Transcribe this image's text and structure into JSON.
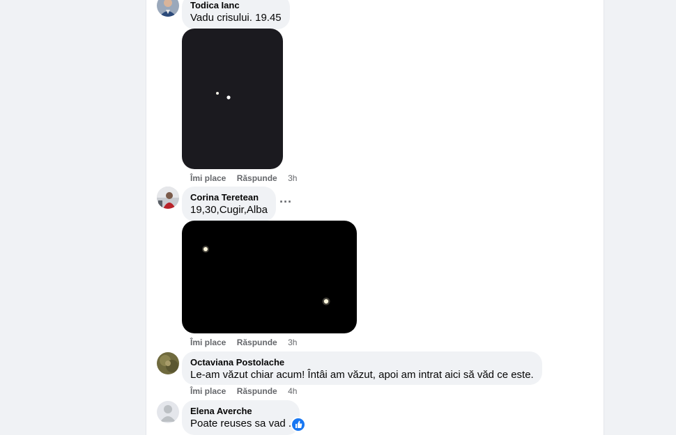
{
  "colors": {
    "page_bg": "#f0f2f5",
    "panel_bg": "#ffffff",
    "bubble_bg": "#f0f2f5",
    "meta_text": "#65676b",
    "like_blue": "#1877f2"
  },
  "comments": [
    {
      "author": "Todica Ianc",
      "text": "Vadu crisului. 19.45",
      "like_label": "Îmi place",
      "reply_label": "Răspunde",
      "time": "3h",
      "has_photo": true
    },
    {
      "author": "Corina Teretean",
      "text": "19,30,Cugir,Alba",
      "like_label": "Îmi place",
      "reply_label": "Răspunde",
      "time": "3h",
      "has_photo": true,
      "more_icon": "more-horizontal-icon"
    },
    {
      "author": "Octaviana Postolache",
      "text": "Le-am văzut chiar acum! Întâi am văzut, apoi am intrat aici să văd ce este.",
      "like_label": "Îmi place",
      "reply_label": "Răspunde",
      "time": "4h"
    },
    {
      "author": "Elena Averche",
      "text": "Poate reuses sa vad .",
      "reaction_icon": "like-reaction-icon"
    }
  ]
}
